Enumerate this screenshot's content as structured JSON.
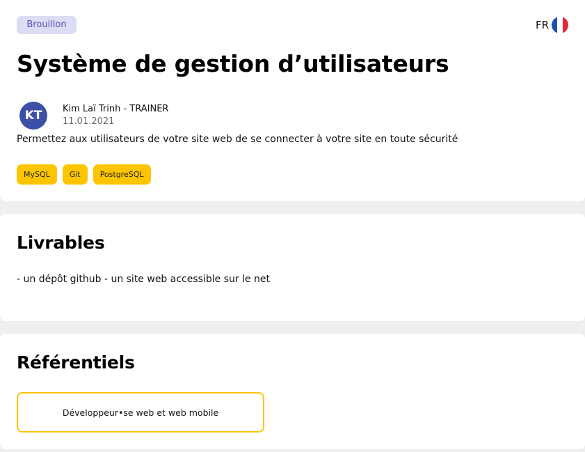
{
  "status_badge": "Brouillon",
  "language": {
    "code": "FR",
    "flag_icon": "french-flag-icon",
    "flag_colors": [
      "#1f4fb0",
      "#ffffff",
      "#e8233a"
    ]
  },
  "project": {
    "title": "Système de gestion d’utilisateurs",
    "author": {
      "initials": "KT",
      "name": "Kim Laï Trinh - TRAINER",
      "date": "11.01.2021"
    },
    "description": "Permettez aux utilisateurs de votre site web de se connecter à votre site en toute sécurité",
    "tags": [
      "MySQL",
      "Git",
      "PostgreSQL"
    ]
  },
  "livrables": {
    "title": "Livrables",
    "text": "- un dépôt github - un site web accessible sur le net"
  },
  "referentiels": {
    "title": "Référentiels",
    "items": [
      "Développeur•se web et web mobile"
    ]
  },
  "colors": {
    "accent_yellow": "#fdc500",
    "badge_bg": "#dcdcf4",
    "badge_text": "#5553b8",
    "avatar_bg": "#3c50a8",
    "page_bg": "#efefef"
  }
}
